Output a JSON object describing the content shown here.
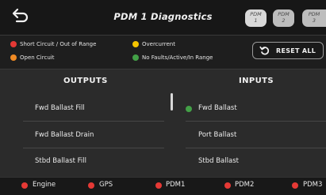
{
  "header": {
    "title": "PDM 1 Diagnostics",
    "pdm_buttons": [
      {
        "line1": "PDM",
        "line2": "1"
      },
      {
        "line1": "PDM",
        "line2": "2"
      },
      {
        "line1": "PDM",
        "line2": "3"
      }
    ]
  },
  "legend": {
    "items": [
      {
        "label": "Short Circuit / Out of Range",
        "color": "#e53935"
      },
      {
        "label": "Overcurrent",
        "color": "#f5c400"
      },
      {
        "label": "Open Circuit",
        "color": "#f08a24"
      },
      {
        "label": "No Faults/Active/In Range",
        "color": "#43a047"
      }
    ],
    "reset_label": "RESET ALL"
  },
  "outputs": {
    "heading": "OUTPUTS",
    "items": [
      "Fwd Ballast Fill",
      "Fwd Ballast Drain",
      "Stbd Ballast Fill"
    ]
  },
  "inputs": {
    "heading": "INPUTS",
    "items": [
      {
        "label": "Fwd Ballast",
        "status_color": "#43a047"
      },
      {
        "label": "Port Ballast"
      },
      {
        "label": "Stbd Ballast"
      }
    ]
  },
  "footer": {
    "items": [
      {
        "label": "Engine",
        "color": "#e53935"
      },
      {
        "label": "GPS",
        "color": "#e53935"
      },
      {
        "label": "PDM1",
        "color": "#e53935"
      },
      {
        "label": "PDM2",
        "color": "#e53935"
      },
      {
        "label": "PDM3",
        "color": "#e53935"
      }
    ]
  }
}
